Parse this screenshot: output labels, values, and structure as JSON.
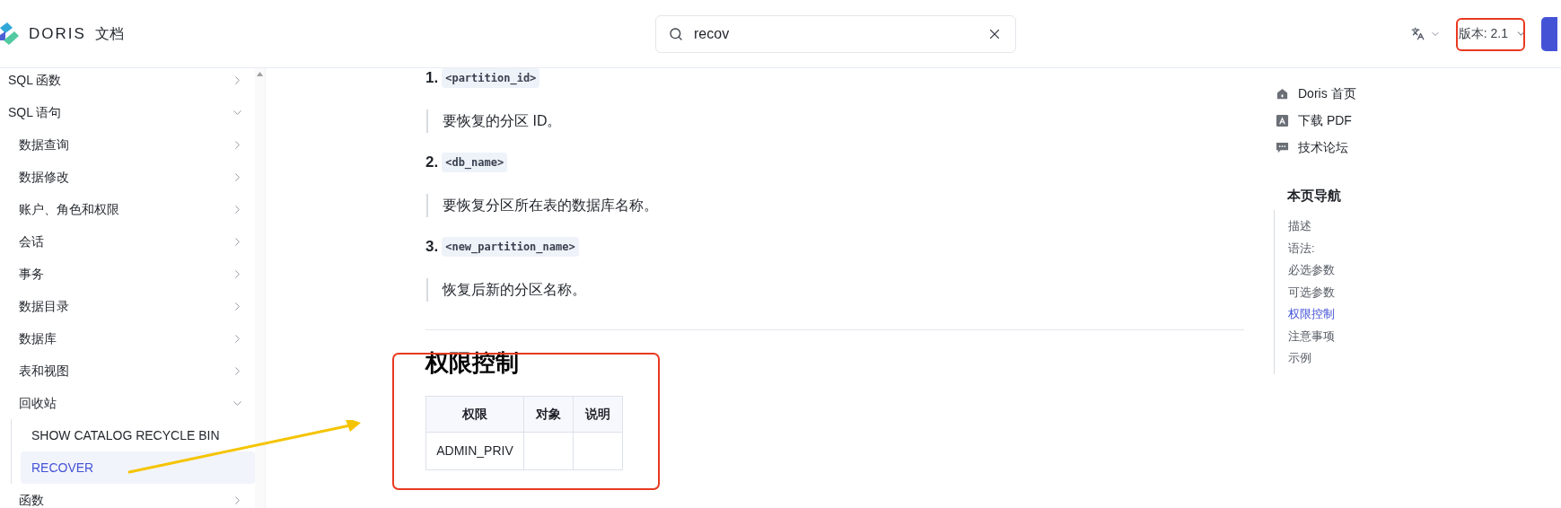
{
  "header": {
    "logo_text": "DORIS",
    "logo_suffix": "文档",
    "search": {
      "value": "recov"
    },
    "version": "版本: 2.1"
  },
  "sidebar": {
    "items": [
      {
        "label": "SQL 函数",
        "expanded": false,
        "selected": false
      },
      {
        "label": "SQL 语句",
        "expanded": true,
        "selected": false,
        "children": [
          {
            "label": "数据查询",
            "expanded": false,
            "selected": false
          },
          {
            "label": "数据修改",
            "expanded": false,
            "selected": false
          },
          {
            "label": "账户、角色和权限",
            "expanded": false,
            "selected": false
          },
          {
            "label": "会话",
            "expanded": false,
            "selected": false
          },
          {
            "label": "事务",
            "expanded": false,
            "selected": false
          },
          {
            "label": "数据目录",
            "expanded": false,
            "selected": false
          },
          {
            "label": "数据库",
            "expanded": false,
            "selected": false
          },
          {
            "label": "表和视图",
            "expanded": false,
            "selected": false
          },
          {
            "label": "回收站",
            "expanded": true,
            "selected": false,
            "children": [
              {
                "label": "SHOW CATALOG RECYCLE BIN",
                "selected": false
              },
              {
                "label": "RECOVER",
                "selected": true
              }
            ]
          },
          {
            "label": "函数",
            "expanded": false,
            "selected": false
          }
        ]
      }
    ]
  },
  "content": {
    "params": [
      {
        "number": "1.",
        "code": "<partition_id>",
        "description": "要恢复的分区 ID。"
      },
      {
        "number": "2.",
        "code": "<db_name>",
        "description": "要恢复分区所在表的数据库名称。"
      },
      {
        "number": "3.",
        "code": "<new_partition_name>",
        "description": "恢复后新的分区名称。"
      }
    ],
    "section_title": "权限控制",
    "table": {
      "columns": [
        "权限",
        "对象",
        "说明"
      ],
      "rows": [
        [
          "ADMIN_PRIV",
          "",
          ""
        ]
      ]
    }
  },
  "right_panel": {
    "links": [
      {
        "kind": "home",
        "label": "Doris 首页"
      },
      {
        "kind": "pdf",
        "label": "下载 PDF"
      },
      {
        "kind": "forum",
        "label": "技术论坛"
      }
    ],
    "toc_title": "本页导航",
    "toc": [
      {
        "label": "描述",
        "selected": false
      },
      {
        "label": "语法:",
        "selected": false
      },
      {
        "label": "必选参数",
        "selected": false
      },
      {
        "label": "可选参数",
        "selected": false
      },
      {
        "label": "权限控制",
        "selected": true
      },
      {
        "label": "注意事项",
        "selected": false
      },
      {
        "label": "示例",
        "selected": false
      }
    ]
  }
}
